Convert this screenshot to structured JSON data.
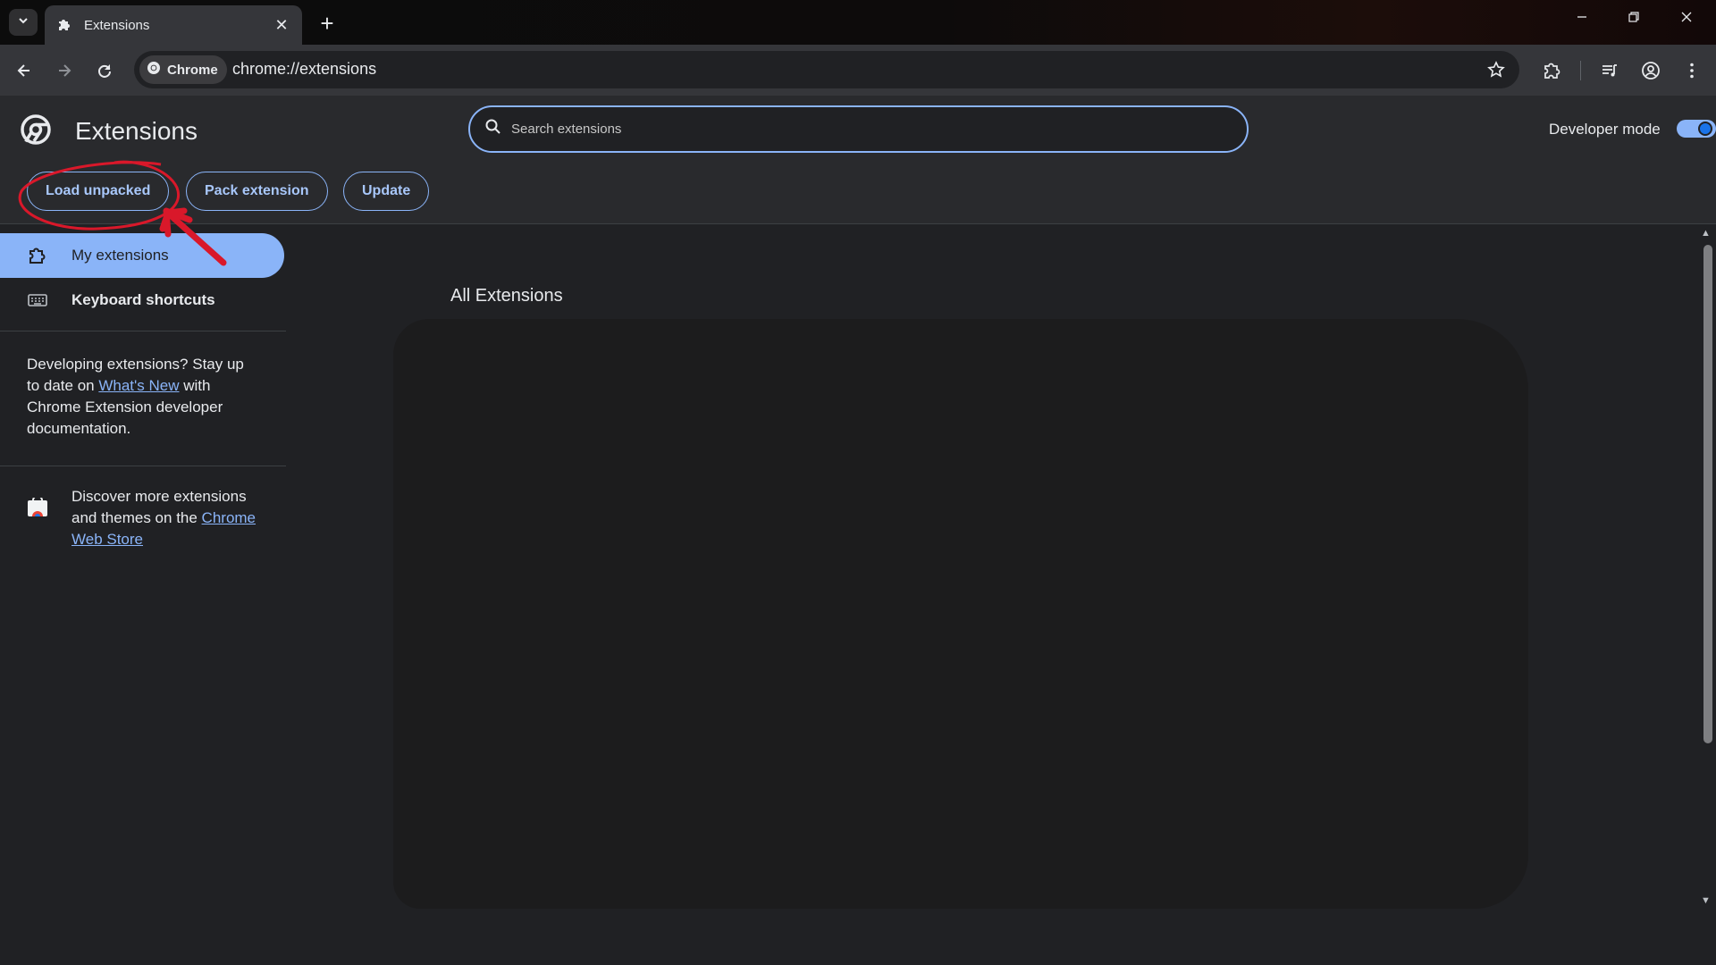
{
  "browser": {
    "tab": {
      "title": "Extensions",
      "close": "✕",
      "icon": "puzzle-icon"
    },
    "new_tab": "+",
    "window_controls": {
      "minimize": "—",
      "restore": "❐",
      "close": "✕"
    },
    "omnibox": {
      "chip_label": "Chrome",
      "url": "chrome://extensions"
    }
  },
  "header": {
    "title": "Extensions",
    "search_placeholder": "Search extensions",
    "developer_mode_label": "Developer mode",
    "developer_mode_on": true,
    "buttons": {
      "load_unpacked": "Load unpacked",
      "pack_extension": "Pack extension",
      "update": "Update"
    }
  },
  "sidebar": {
    "items": [
      {
        "label": "My extensions",
        "icon": "extensions-icon",
        "active": true
      },
      {
        "label": "Keyboard shortcuts",
        "icon": "keyboard-icon",
        "active": false
      }
    ],
    "dev_text": {
      "part1": "Developing extensions? Stay up to date on ",
      "link": "What's New",
      "part2": " with Chrome Extension developer documentation."
    },
    "store_text": {
      "part1": "Discover more extensions and themes on the ",
      "link": "Chrome Web Store"
    }
  },
  "main": {
    "section_title": "All Extensions"
  },
  "colors": {
    "accent": "#8ab4f8",
    "annotation": "#d9182a",
    "background": "#202124",
    "header": "#292a2d"
  }
}
